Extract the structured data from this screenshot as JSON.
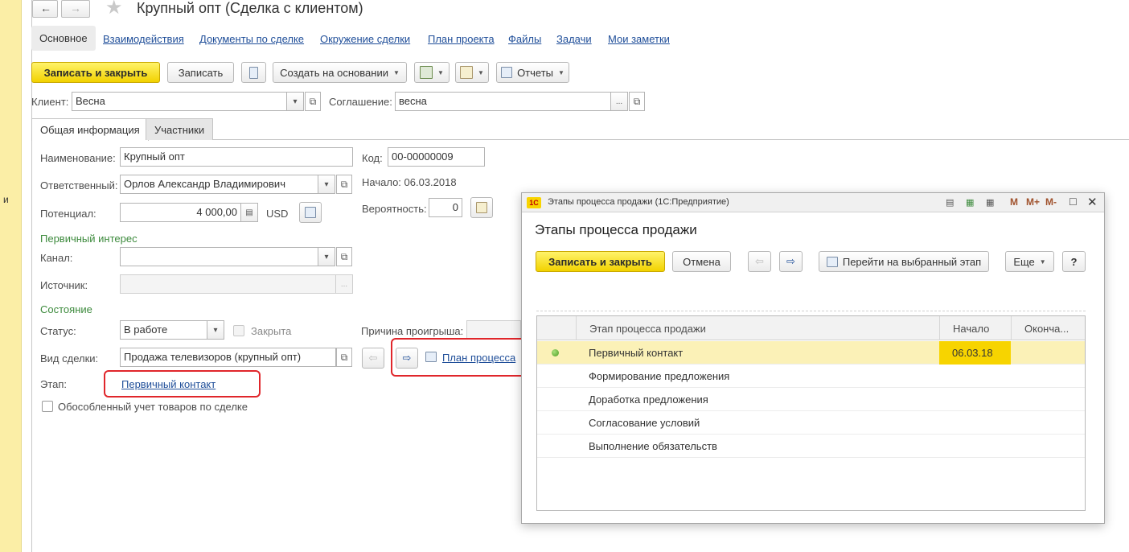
{
  "window": {
    "title": "Крупный опт (Сделка с клиентом)",
    "left_strip_char": "и"
  },
  "nav_tabs": [
    {
      "label": "Основное",
      "active": true
    },
    {
      "label": "Взаимодействия"
    },
    {
      "label": "Документы по сделке"
    },
    {
      "label": "Окружение сделки"
    },
    {
      "label": "План проекта"
    },
    {
      "label": "Файлы"
    },
    {
      "label": "Задачи"
    },
    {
      "label": "Мои заметки"
    }
  ],
  "toolbar": {
    "save_close": "Записать и закрыть",
    "save": "Записать",
    "create_based": "Создать на основании",
    "reports": "Отчеты"
  },
  "header_fields": {
    "client_label": "Клиент:",
    "client_value": "Весна",
    "agreement_label": "Соглашение:",
    "agreement_value": "весна"
  },
  "form_tabs": {
    "general": "Общая информация",
    "participants": "Участники"
  },
  "form": {
    "name_label": "Наименование:",
    "name_value": "Крупный опт",
    "code_label": "Код:",
    "code_value": "00-00000009",
    "responsible_label": "Ответственный:",
    "responsible_value": "Орлов Александр Владимирович",
    "start_text": "Начало: 06.03.2018",
    "potential_label": "Потенциал:",
    "potential_value": "4 000,00",
    "currency": "USD",
    "probability_label": "Вероятность:",
    "probability_value": "0",
    "primary_interest_section": "Первичный интерес",
    "channel_label": "Канал:",
    "channel_value": "",
    "source_label": "Источник:",
    "source_value": "",
    "state_section": "Состояние",
    "status_label": "Статус:",
    "status_value": "В работе",
    "closed_label": "Закрыта",
    "loss_reason_label": "Причина проигрыша:",
    "deal_type_label": "Вид сделки:",
    "deal_type_value": "Продажа телевизоров (крупный опт)",
    "stage_label": "Этап:",
    "stage_link": "Первичный контакт",
    "process_plan_link": "План процесса",
    "separate_accounting_label": "Обособленный учет товаров по сделке"
  },
  "modal": {
    "window_title": "Этапы процесса продажи  (1С:Предприятие)",
    "logo_text": "1С",
    "header_icons": [
      "M",
      "M+",
      "M-"
    ],
    "title": "Этапы процесса продажи",
    "save_close": "Записать и закрыть",
    "cancel": "Отмена",
    "goto_stage": "Перейти на выбранный этап",
    "more": "Еще",
    "help": "?",
    "columns": [
      "Этап процесса продажи",
      "Начало",
      "Оконча..."
    ],
    "rows": [
      {
        "stage": "Первичный контакт",
        "start": "06.03.18",
        "end": "",
        "current": true
      },
      {
        "stage": "Формирование предложения",
        "start": "",
        "end": ""
      },
      {
        "stage": "Доработка предложения",
        "start": "",
        "end": ""
      },
      {
        "stage": "Согласование условий",
        "start": "",
        "end": ""
      },
      {
        "stage": "Выполнение обязательств",
        "start": "",
        "end": ""
      }
    ]
  },
  "colors": {
    "accent_yellow": "#f5d800",
    "link_blue": "#1f4e99",
    "section_green": "#3c8a3c",
    "highlight_red": "#e0262b",
    "selected_row": "#fbf1b7"
  }
}
